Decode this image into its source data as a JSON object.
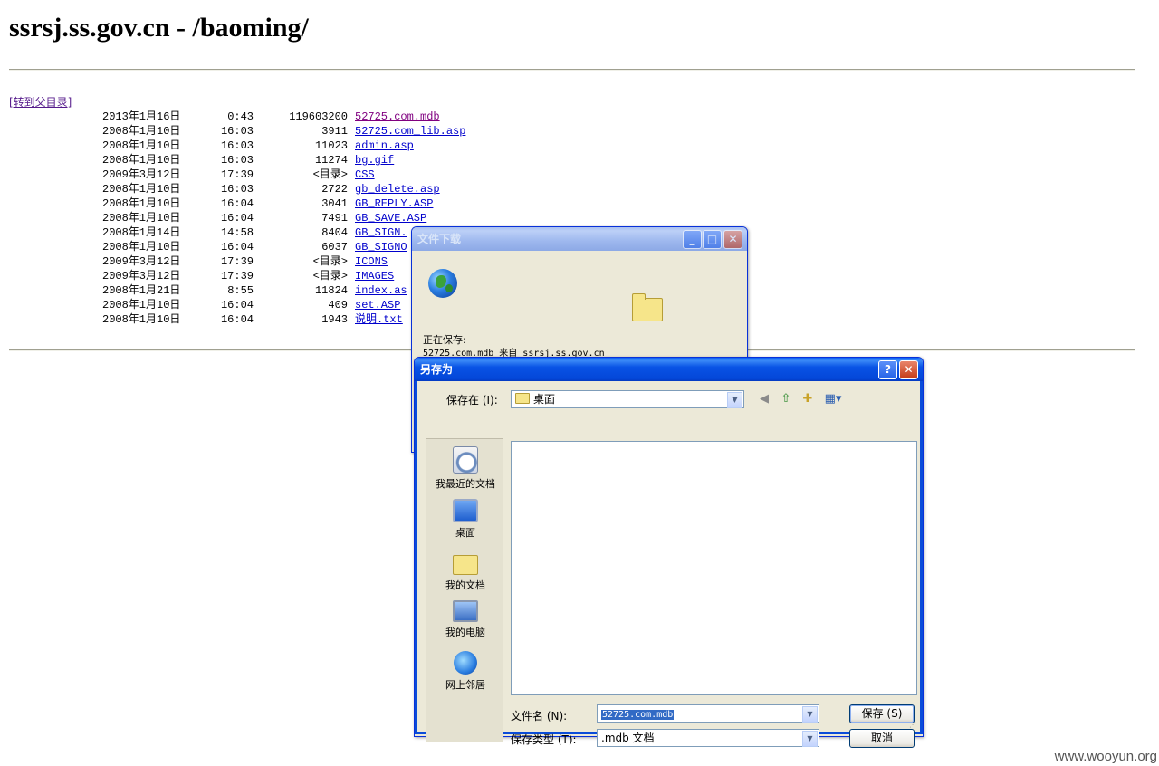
{
  "page": {
    "title": "ssrsj.ss.gov.cn - /baoming/",
    "parent_link": "[转到父目录]",
    "entries": [
      {
        "date": "2013年1月16日",
        "time": "0:43",
        "size": "119603200",
        "name": "52725.com.mdb",
        "visited": true
      },
      {
        "date": "2008年1月10日",
        "time": "16:03",
        "size": "3911",
        "name": "52725.com_lib.asp",
        "visited": false
      },
      {
        "date": "2008年1月10日",
        "time": "16:03",
        "size": "11023",
        "name": "admin.asp",
        "visited": false
      },
      {
        "date": "2008年1月10日",
        "time": "16:03",
        "size": "11274",
        "name": "bg.gif",
        "visited": false
      },
      {
        "date": "2009年3月12日",
        "time": "17:39",
        "size": "<目录>",
        "name": "CSS",
        "visited": false
      },
      {
        "date": "2008年1月10日",
        "time": "16:03",
        "size": "2722",
        "name": "gb_delete.asp",
        "visited": false
      },
      {
        "date": "2008年1月10日",
        "time": "16:04",
        "size": "3041",
        "name": "GB_REPLY.ASP",
        "visited": false
      },
      {
        "date": "2008年1月10日",
        "time": "16:04",
        "size": "7491",
        "name": "GB_SAVE.ASP",
        "visited": false
      },
      {
        "date": "2008年1月14日",
        "time": "14:58",
        "size": "8404",
        "name": "GB_SIGN.",
        "visited": false
      },
      {
        "date": "2008年1月10日",
        "time": "16:04",
        "size": "6037",
        "name": "GB_SIGNO",
        "visited": false
      },
      {
        "date": "2009年3月12日",
        "time": "17:39",
        "size": "<目录>",
        "name": "ICONS",
        "visited": false
      },
      {
        "date": "2009年3月12日",
        "time": "17:39",
        "size": "<目录>",
        "name": "IMAGES",
        "visited": false
      },
      {
        "date": "2008年1月21日",
        "time": "8:55",
        "size": "11824",
        "name": "index.as",
        "visited": false
      },
      {
        "date": "2008年1月10日",
        "time": "16:04",
        "size": "409",
        "name": "set.ASP",
        "visited": false
      },
      {
        "date": "2008年1月10日",
        "time": "16:04",
        "size": "1943",
        "name": "说明.txt",
        "visited": false
      }
    ]
  },
  "download_dialog": {
    "title": "文件下载",
    "saving_label": "正在保存:",
    "detail": "52725.com.mdb 来自 ssrsj.ss.gov.cn",
    "buttons": {
      "minimize": "_",
      "maximize": "□",
      "close": "✕"
    }
  },
  "save_dialog": {
    "title": "另存为",
    "help_button": "?",
    "close_button": "✕",
    "save_in_label": "保存在 (I):",
    "save_in_value": "桌面",
    "places": [
      "我最近的文档",
      "桌面",
      "我的文档",
      "我的电脑",
      "网上邻居"
    ],
    "filename_label": "文件名 (N):",
    "filename_value": "52725.com.mdb",
    "filetype_label": "保存类型 (T):",
    "filetype_value": ".mdb 文档",
    "save_button": "保存 (S)",
    "cancel_button": "取消"
  },
  "watermark": "www.wooyun.org"
}
